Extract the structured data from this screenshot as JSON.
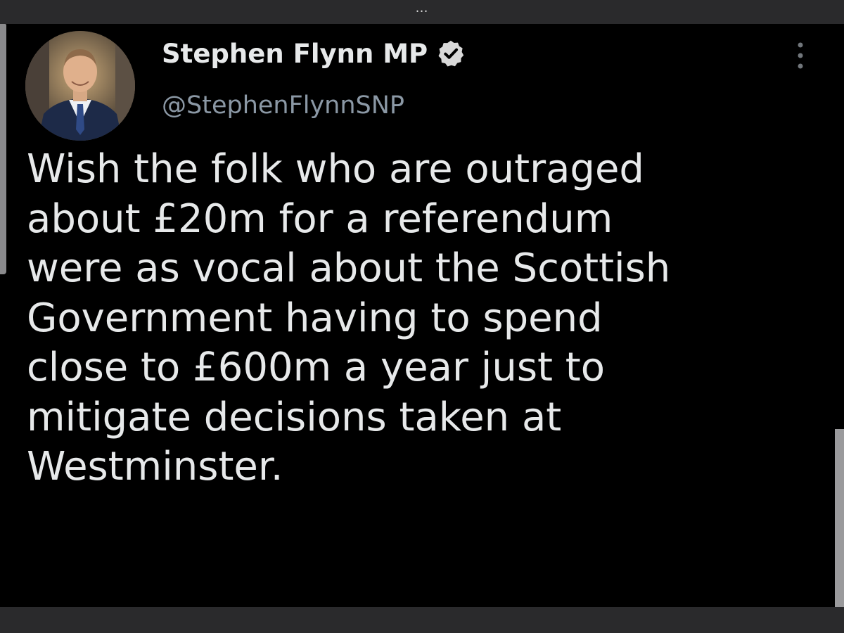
{
  "window": {
    "top_menu_glyph": "…"
  },
  "tweet": {
    "author": {
      "display_name": "Stephen Flynn MP",
      "handle": "@StephenFlynnSNP",
      "verified": true
    },
    "text_lines": [
      "Wish the folk who are outraged",
      "about £20m for a referendum",
      "were as vocal about the Scottish",
      "Government having to spend",
      "close to £600m a year just to",
      "mitigate decisions taken at",
      "Westminster."
    ]
  },
  "icons": {
    "verified": "verified-check-badge-icon",
    "more": "three-dots-vertical-icon",
    "window_menu": "three-dots-horizontal-icon"
  },
  "colors": {
    "background": "#000000",
    "chrome": "#2a2a2c",
    "text_primary": "#e7e9ea",
    "text_secondary": "#8b98a5",
    "verified_badge": "#d9d9d9"
  }
}
